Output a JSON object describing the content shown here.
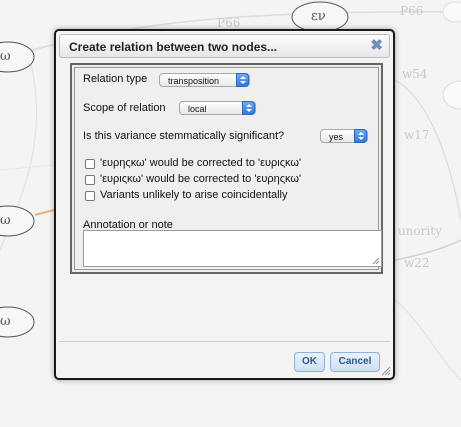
{
  "background": {
    "node_labels": [
      "εν",
      "ω",
      "ω",
      "ω"
    ],
    "edge_labels": [
      "P66",
      "P66",
      "w54",
      "w17",
      "unority",
      "w22"
    ]
  },
  "dialog": {
    "title": "Create relation between two nodes...",
    "close_icon": "close-icon",
    "relation_type": {
      "label": "Relation type",
      "value": "transposition"
    },
    "scope": {
      "label": "Scope of relation",
      "value": "local"
    },
    "significance": {
      "label": "Is this variance stemmatically significant?",
      "value": "yes"
    },
    "checkboxes": [
      {
        "label": "'ευρηςκω' would be corrected to 'ευριςκω'",
        "checked": false
      },
      {
        "label": "'ευριςκω' would be corrected to 'ευρηςκω'",
        "checked": false
      },
      {
        "label": "Variants unlikely to arise coincidentally",
        "checked": false
      }
    ],
    "annotation": {
      "label": "Annotation or note",
      "value": ""
    },
    "buttons": {
      "ok": "OK",
      "cancel": "Cancel"
    },
    "accent_color": "#3a86ea"
  }
}
